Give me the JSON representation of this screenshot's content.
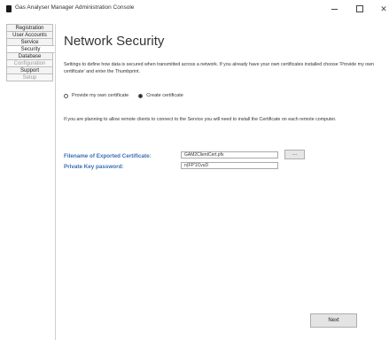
{
  "window": {
    "title": "Gas Analyser Manager Administration Console",
    "minimize_glyph": "—",
    "close_glyph": "✕"
  },
  "sidebar": {
    "items": [
      {
        "label": "Registration",
        "state": "normal"
      },
      {
        "label": "User Accounts",
        "state": "normal"
      },
      {
        "label": "Service",
        "state": "normal"
      },
      {
        "label": "Security",
        "state": "active"
      },
      {
        "label": "Database",
        "state": "normal"
      },
      {
        "label": "Configuration",
        "state": "disabled"
      },
      {
        "label": "Support",
        "state": "normal"
      },
      {
        "label": "Setup",
        "state": "disabled"
      }
    ]
  },
  "main": {
    "title": "Network Security",
    "description": "Settings to define how data is secured when transmitted across a network. If you already have your own certificates installed choose 'Provide my own certificate' and enter the Thumbprint.",
    "radio_options": [
      {
        "label": "Provide my own certificate",
        "selected": false
      },
      {
        "label": "Create certificate",
        "selected": true
      }
    ],
    "info": "If you are planning to allow remote clients to connect to the Service you will need to install the Certificate on each remote computer.",
    "filename_label": "Filename of Exported Certificate:",
    "filename_value": "GAM2ClientCert.pfx",
    "password_label": "Private Key password:",
    "password_value": "n(FP'1CvuD",
    "browse_label": "...",
    "next_label": "Next"
  }
}
